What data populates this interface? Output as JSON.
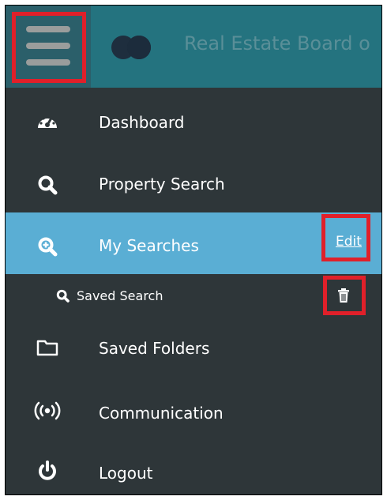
{
  "header": {
    "menu_icon": "hamburger-menu-icon",
    "logo_icon": "two-circles-logo",
    "brand_text": "Real Estate Board o"
  },
  "nav": {
    "items": [
      {
        "label": "Dashboard",
        "icon": "speedometer-icon"
      },
      {
        "label": "Property Search",
        "icon": "search-icon"
      },
      {
        "label": "My Searches",
        "icon": "search-plus-icon",
        "active": true,
        "action": "Edit"
      },
      {
        "label": "Saved Folders",
        "icon": "folder-icon"
      },
      {
        "label": "Communication",
        "icon": "broadcast-icon"
      },
      {
        "label": "Logout",
        "icon": "power-icon"
      }
    ],
    "saved_search": {
      "label": "Saved Search",
      "icon": "search-icon",
      "delete_icon": "trash-icon"
    }
  },
  "colors": {
    "sidebar_bg": "#2e3639",
    "topbar_bg": "#24737f",
    "active_bg": "#5aaed4",
    "highlight_red": "#e0202a"
  }
}
